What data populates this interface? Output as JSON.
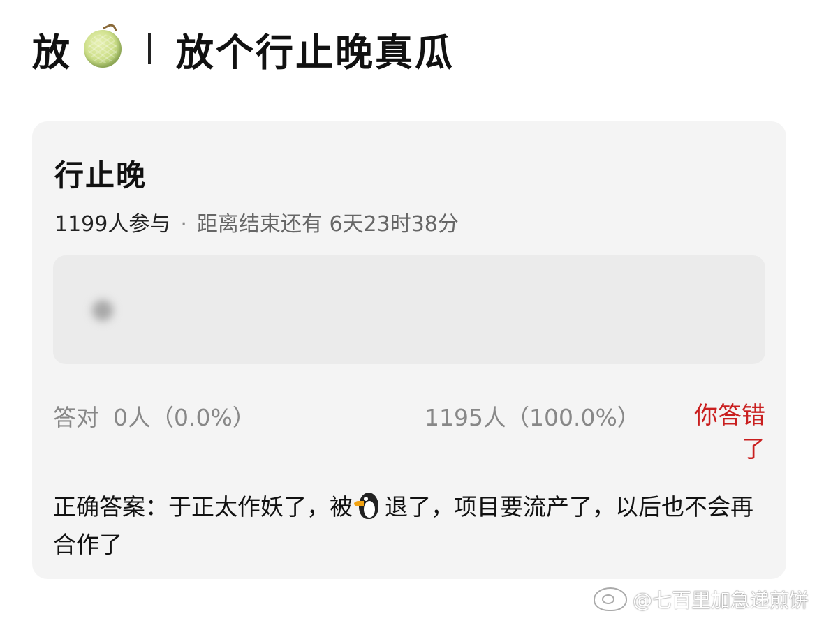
{
  "header": {
    "prefix": "放",
    "icon": "melon-icon",
    "separator": "丨",
    "title": "放个行止晚真瓜"
  },
  "quiz": {
    "title": "行止晚",
    "participants": "1199人参与",
    "dot": "·",
    "countdown": "距离结束还有 6天23时38分",
    "stat_left_label": "答对",
    "stat_left_value": "0人（0.0%）",
    "stat_right_value": "1195人（100.0%）",
    "result": "你答错了",
    "answer_part1": "正确答案：于正太作妖了，被",
    "answer_icon": "penguin-icon",
    "answer_part2": "退了，项目要流产了，以后也不会再合作了"
  },
  "watermark": {
    "icon": "weibo-icon",
    "text": "@七百里加急递煎饼"
  },
  "colors": {
    "card_bg": "#f4f4f4",
    "wrong_red": "#c91f1f",
    "muted_gray": "#888888"
  }
}
